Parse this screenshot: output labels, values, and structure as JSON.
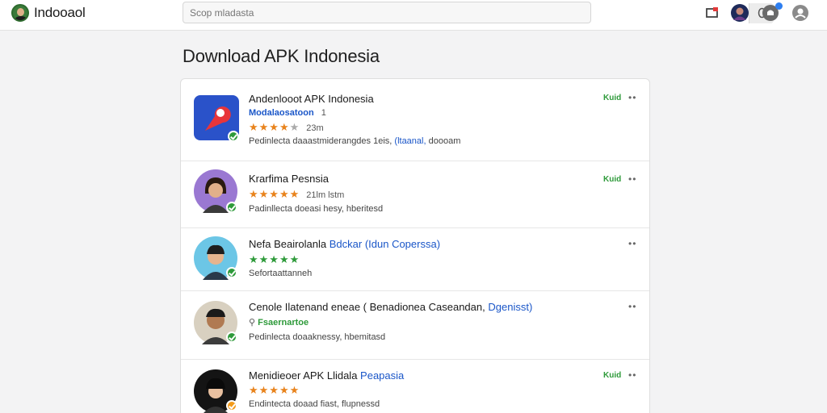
{
  "header": {
    "brand": "Indooaol",
    "search_placeholder": "Scop mladasta",
    "colors": {
      "accent": "#1a56c8",
      "badge_green": "#2e9a3a",
      "star_orange": "#e8831c",
      "notification": "#2d7ef0"
    }
  },
  "page": {
    "title": "Download APK Indonesia"
  },
  "items": [
    {
      "title": "Andenlooot APK Indonesia",
      "developer": "Modalaosatoon",
      "developer_suffix": "1",
      "rating_stars": 4,
      "meta": "23m",
      "desc_start": "Pedinlecta daaastmiderangdes 1eis,",
      "desc_link": "(ltaanal,",
      "desc_end": "doooam",
      "badge": "Kuid",
      "more": "••",
      "icon": "app-logo-icon"
    },
    {
      "title": "Krarfima Pesnsia",
      "rating_stars": 5,
      "meta": "21lm lstm",
      "desc": "Padinllecta doeasi hesy, hberitesd",
      "badge": "Kuid",
      "more": "••",
      "icon": "user-avatar-icon"
    },
    {
      "title": "Nefa Beairolanla",
      "title_link": "Bdckar (Idun Coperssa)",
      "rating_stars": 5,
      "desc": "Sefortaattanneh",
      "more": "••",
      "icon": "user-avatar-icon"
    },
    {
      "title": "Cenole Ilatenand eneae ( Benadionea Caseandan,",
      "title_link": "Dgenisst)",
      "developer": "Fsaernartoe",
      "desc": "Pedinlecta doaaknessy, hbemitasd",
      "more": "••",
      "icon": "user-avatar-icon"
    },
    {
      "title": "Menidieoer APK Llidala",
      "title_link": "Peapasia",
      "rating_stars": 5,
      "desc": "Endintecta doaad fiast, flupnessd",
      "badge": "Kuid",
      "more": "••",
      "icon": "user-avatar-icon"
    }
  ]
}
